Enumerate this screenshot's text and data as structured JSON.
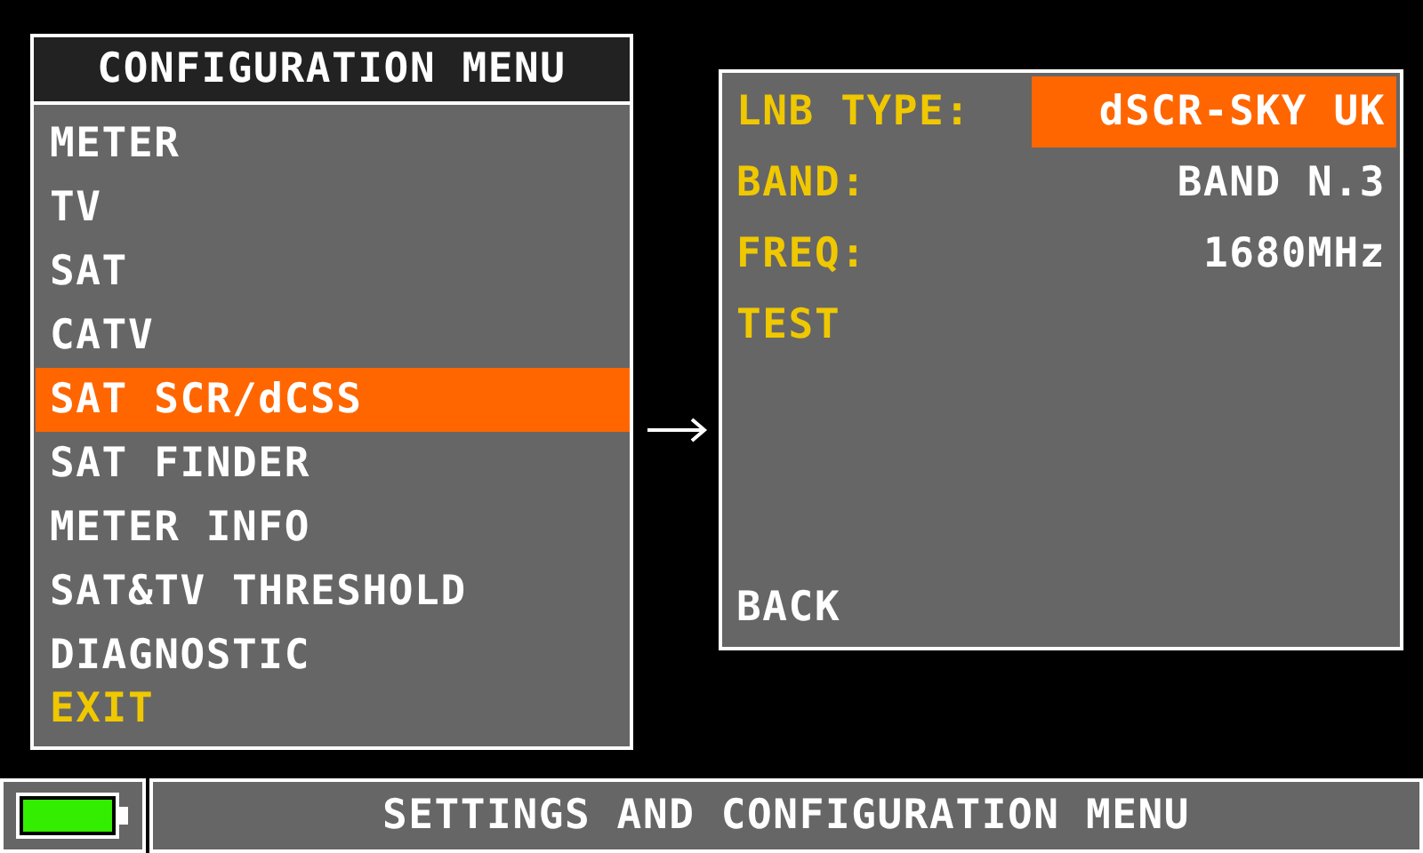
{
  "menu": {
    "title": "CONFIGURATION MENU",
    "items": [
      {
        "label": "METER",
        "kind": "item",
        "selected": false
      },
      {
        "label": "TV",
        "kind": "item",
        "selected": false
      },
      {
        "label": "SAT",
        "kind": "item",
        "selected": false
      },
      {
        "label": "CATV",
        "kind": "item",
        "selected": false
      },
      {
        "label": "SAT SCR/dCSS",
        "kind": "item",
        "selected": true
      },
      {
        "label": "SAT FINDER",
        "kind": "item",
        "selected": false
      },
      {
        "label": "METER INFO",
        "kind": "item",
        "selected": false
      },
      {
        "label": "SAT&TV THRESHOLD",
        "kind": "item",
        "selected": false
      },
      {
        "label": "DIAGNOSTIC",
        "kind": "item",
        "selected": false
      },
      {
        "label": "EXIT",
        "kind": "exit",
        "selected": false
      }
    ]
  },
  "submenu": {
    "rows": [
      {
        "label": "LNB TYPE:",
        "value": "dSCR-SKY UK",
        "kind": "field",
        "selected": true
      },
      {
        "label": "BAND:",
        "value": "BAND N.3",
        "kind": "field",
        "selected": false
      },
      {
        "label": "FREQ:",
        "value": "1680MHz",
        "kind": "field",
        "selected": false
      },
      {
        "label": "TEST",
        "kind": "field",
        "selected": false
      }
    ],
    "back": "BACK"
  },
  "status_bar": {
    "text": "SETTINGS AND CONFIGURATION MENU"
  }
}
